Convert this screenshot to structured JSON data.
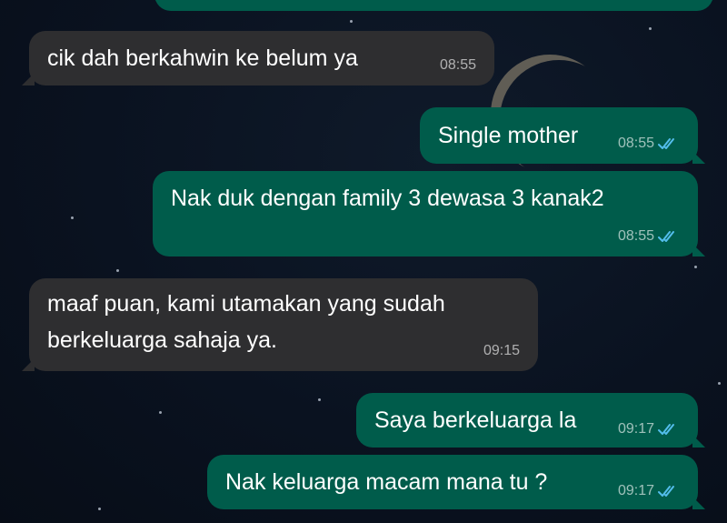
{
  "messages": [
    {
      "text": "cik dah berkahwin ke belum ya",
      "time": "08:55",
      "direction": "incoming"
    },
    {
      "text": "Single mother",
      "time": "08:55",
      "direction": "outgoing",
      "status_icon": "read-double-check-icon"
    },
    {
      "text": "Nak duk dengan family 3 dewasa 3 kanak2",
      "time": "08:55",
      "direction": "outgoing",
      "status_icon": "read-double-check-icon"
    },
    {
      "text": "maaf puan, kami utamakan yang sudah\nberkeluarga sahaja ya.",
      "time": "09:15",
      "direction": "incoming"
    },
    {
      "text": "Saya berkeluarga la",
      "time": "09:17",
      "direction": "outgoing",
      "status_icon": "read-double-check-icon"
    },
    {
      "text": "Nak keluarga macam mana tu ?",
      "time": "09:17",
      "direction": "outgoing",
      "status_icon": "read-double-check-icon"
    }
  ],
  "colors": {
    "incoming_bubble": "#2e2e30",
    "outgoing_bubble": "#005c4b",
    "read_tick": "#53bdeb",
    "wallpaper": "#0a1220"
  }
}
